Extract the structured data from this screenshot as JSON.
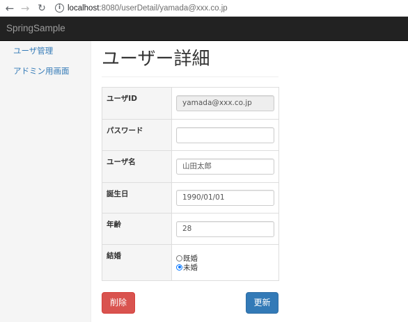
{
  "browser": {
    "back_icon": "←",
    "forward_icon": "→",
    "reload_icon": "↻",
    "info_icon": "i",
    "url_host": "localhost",
    "url_rest": ":8080/userDetail/yamada@xxx.co.jp"
  },
  "navbar": {
    "brand": "SpringSample"
  },
  "sidebar": {
    "items": [
      {
        "label": "ユーザ管理"
      },
      {
        "label": "アドミン用画面"
      }
    ]
  },
  "main": {
    "title": "ユーザー詳細",
    "form": {
      "user_id": {
        "label": "ユーザID",
        "value": "yamada@xxx.co.jp"
      },
      "password": {
        "label": "パスワード",
        "value": ""
      },
      "user_name": {
        "label": "ユーザ名",
        "value": "山田太郎"
      },
      "birthday": {
        "label": "誕生日",
        "value": "1990/01/01"
      },
      "age": {
        "label": "年齢",
        "value": "28"
      },
      "marriage": {
        "label": "結婚",
        "options": [
          {
            "label": "既婚",
            "checked": false
          },
          {
            "label": "未婚",
            "checked": true
          }
        ]
      }
    },
    "buttons": {
      "delete": "削除",
      "update": "更新"
    }
  },
  "colors": {
    "navbar_bg": "#222222",
    "link": "#337ab7",
    "danger": "#d9534f",
    "primary": "#337ab7"
  }
}
